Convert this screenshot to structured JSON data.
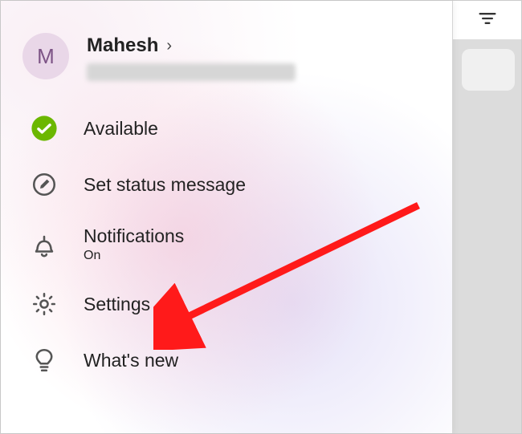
{
  "profile": {
    "avatar_initial": "M",
    "name": "Mahesh",
    "chevron": "›"
  },
  "menu": {
    "available": {
      "label": "Available"
    },
    "status": {
      "label": "Set status message"
    },
    "notifications": {
      "label": "Notifications",
      "sub": "On"
    },
    "settings": {
      "label": "Settings"
    },
    "whatsnew": {
      "label": "What's new"
    }
  }
}
